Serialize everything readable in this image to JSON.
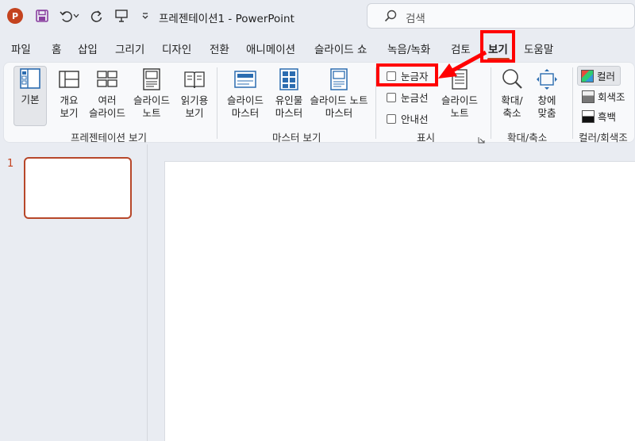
{
  "app": {
    "title": "프레젠테이션1  -  PowerPoint",
    "logo_letter": "P"
  },
  "search": {
    "placeholder": "검색"
  },
  "menu": {
    "tabs": [
      "파일",
      "홈",
      "삽입",
      "그리기",
      "디자인",
      "전환",
      "애니메이션",
      "슬라이드 쇼",
      "녹음/녹화",
      "검토",
      "보기",
      "도움말"
    ],
    "active": "보기"
  },
  "ribbon": {
    "groups": {
      "presentation_views": {
        "label": "프레젠테이션 보기",
        "buttons": [
          "기본",
          "개요\n보기",
          "여러\n슬라이드",
          "슬라이드\n노트",
          "읽기용\n보기"
        ]
      },
      "master_views": {
        "label": "마스터 보기",
        "buttons": [
          "슬라이드\n마스터",
          "유인물\n마스터",
          "슬라이드 노트\n마스터"
        ]
      },
      "show": {
        "label": "표시",
        "checkboxes": [
          "눈금자",
          "눈금선",
          "안내선"
        ],
        "button": "슬라이드\n노트"
      },
      "zoom": {
        "label": "확대/축소",
        "buttons": [
          "확대/\n축소",
          "창에\n맞춤"
        ]
      },
      "color": {
        "label": "컬러/회색조",
        "options": [
          "컬러",
          "회색조",
          "흑백"
        ]
      }
    }
  },
  "thumbnails": {
    "slide_number": "1"
  },
  "colors": {
    "accent": "#c4431f",
    "highlight": "#ff0000"
  }
}
